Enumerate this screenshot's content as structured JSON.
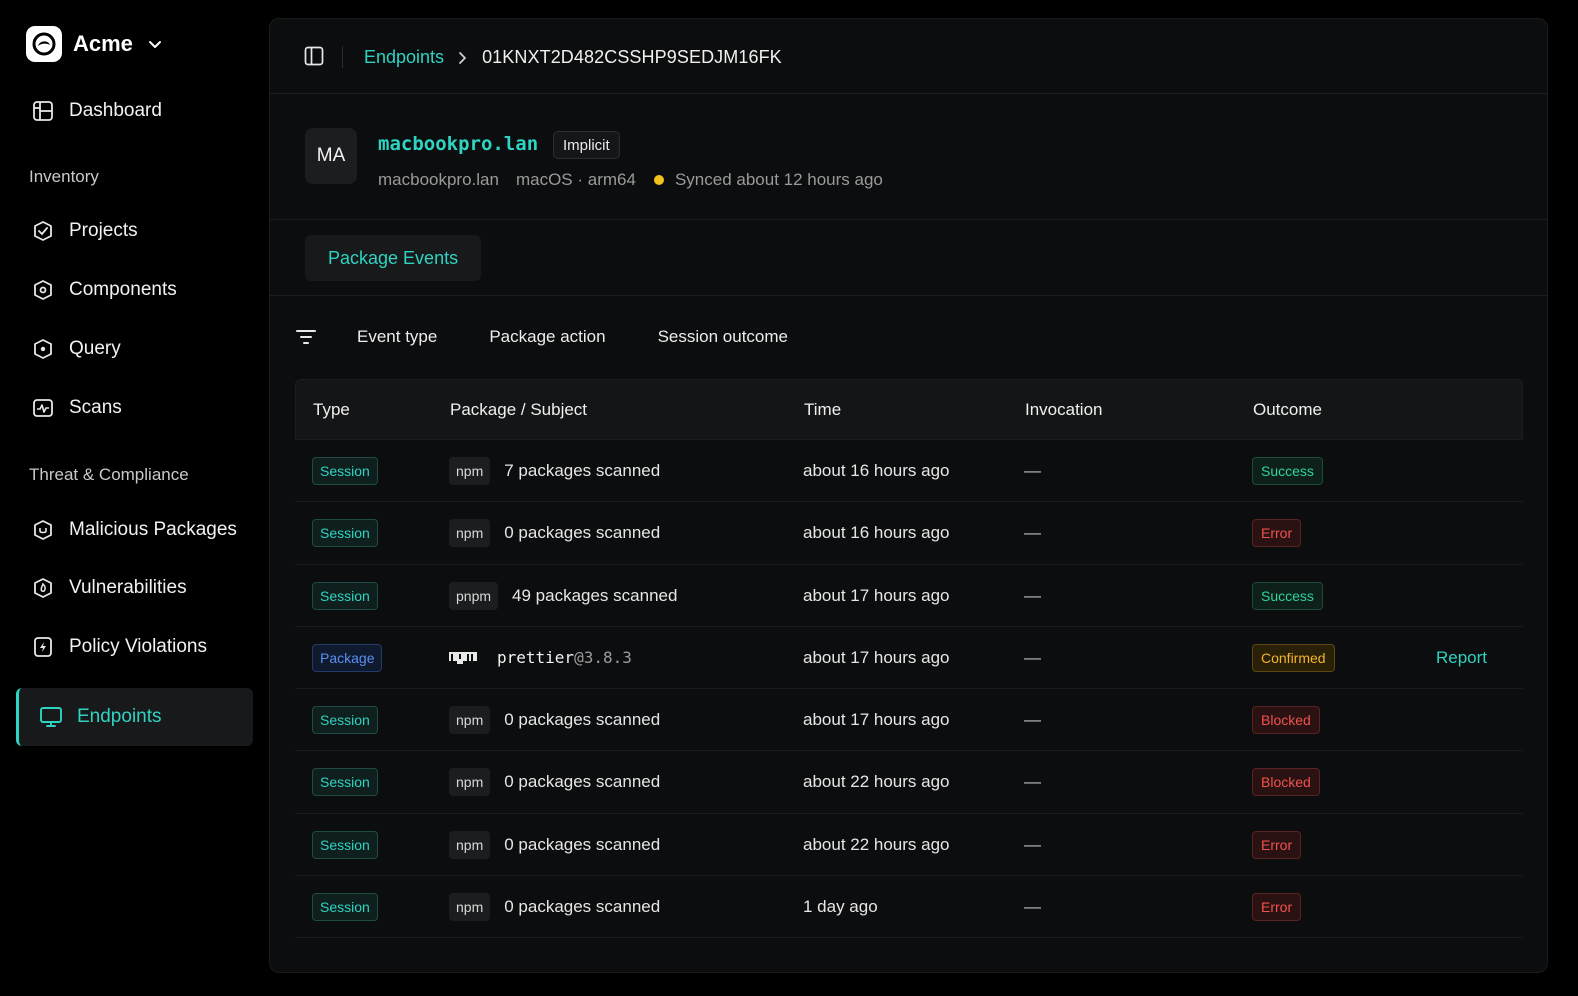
{
  "sidebar": {
    "org": {
      "name": "Acme"
    },
    "dashboard": "Dashboard",
    "section_inventory": "Inventory",
    "projects": "Projects",
    "components": "Components",
    "query": "Query",
    "scans": "Scans",
    "section_threat": "Threat & Compliance",
    "malicious": "Malicious Packages",
    "vulnerabilities": "Vulnerabilities",
    "policy": "Policy Violations",
    "endpoints": "Endpoints"
  },
  "breadcrumb": {
    "parent": "Endpoints",
    "separator": "›",
    "current": "01KNXT2D482CSSHP9SEDJM16FK"
  },
  "endpoint": {
    "initials": "MA",
    "title": "macbookpro.lan",
    "badge": "Implicit",
    "hostname": "macbookpro.lan",
    "platform": "macOS · arm64",
    "sync_status": "Synced about 12 hours ago",
    "sync_color": "#f2c31b"
  },
  "tabs": {
    "package_events": "Package Events"
  },
  "filters": {
    "event_type": "Event type",
    "package_action": "Package action",
    "session_outcome": "Session outcome"
  },
  "table": {
    "headers": {
      "type": "Type",
      "package": "Package / Subject",
      "time": "Time",
      "invocation": "Invocation",
      "outcome": "Outcome"
    },
    "rows": [
      {
        "type": "Session",
        "ecosystem": "npm",
        "subject": "7 packages scanned",
        "time": "about 16 hours ago",
        "invocation": "—",
        "outcome": "Success"
      },
      {
        "type": "Session",
        "ecosystem": "npm",
        "subject": "0 packages scanned",
        "time": "about 16 hours ago",
        "invocation": "—",
        "outcome": "Error"
      },
      {
        "type": "Session",
        "ecosystem": "pnpm",
        "subject": "49 packages scanned",
        "time": "about 17 hours ago",
        "invocation": "—",
        "outcome": "Success"
      },
      {
        "type": "Package",
        "package_name": "prettier",
        "package_version": "@3.8.3",
        "time": "about 17 hours ago",
        "invocation": "—",
        "outcome": "Confirmed",
        "action": "Report"
      },
      {
        "type": "Session",
        "ecosystem": "npm",
        "subject": "0 packages scanned",
        "time": "about 17 hours ago",
        "invocation": "—",
        "outcome": "Blocked"
      },
      {
        "type": "Session",
        "ecosystem": "npm",
        "subject": "0 packages scanned",
        "time": "about 22 hours ago",
        "invocation": "—",
        "outcome": "Blocked"
      },
      {
        "type": "Session",
        "ecosystem": "npm",
        "subject": "0 packages scanned",
        "time": "about 22 hours ago",
        "invocation": "—",
        "outcome": "Error"
      },
      {
        "type": "Session",
        "ecosystem": "npm",
        "subject": "0 packages scanned",
        "time": "1 day ago",
        "invocation": "—",
        "outcome": "Error"
      }
    ]
  },
  "colors": {
    "accent": "#2fd3c1",
    "success": "#2fd3a0",
    "error": "#f0524f",
    "warning": "#f2b52a",
    "package_tag": "#5b8ff2"
  },
  "icons": {
    "org": "acme-logo-icon",
    "dashboard": "dashboard-grid-icon",
    "projects": "projects-icon",
    "components": "components-icon",
    "query": "query-icon",
    "scans": "scans-icon",
    "malicious": "malicious-shield-icon",
    "vulnerabilities": "vulnerability-flame-icon",
    "policy": "policy-icon",
    "endpoints": "monitor-icon",
    "panel_toggle": "sidebar-toggle-icon",
    "filter": "filter-icon",
    "npm": "npm-logo-icon"
  }
}
